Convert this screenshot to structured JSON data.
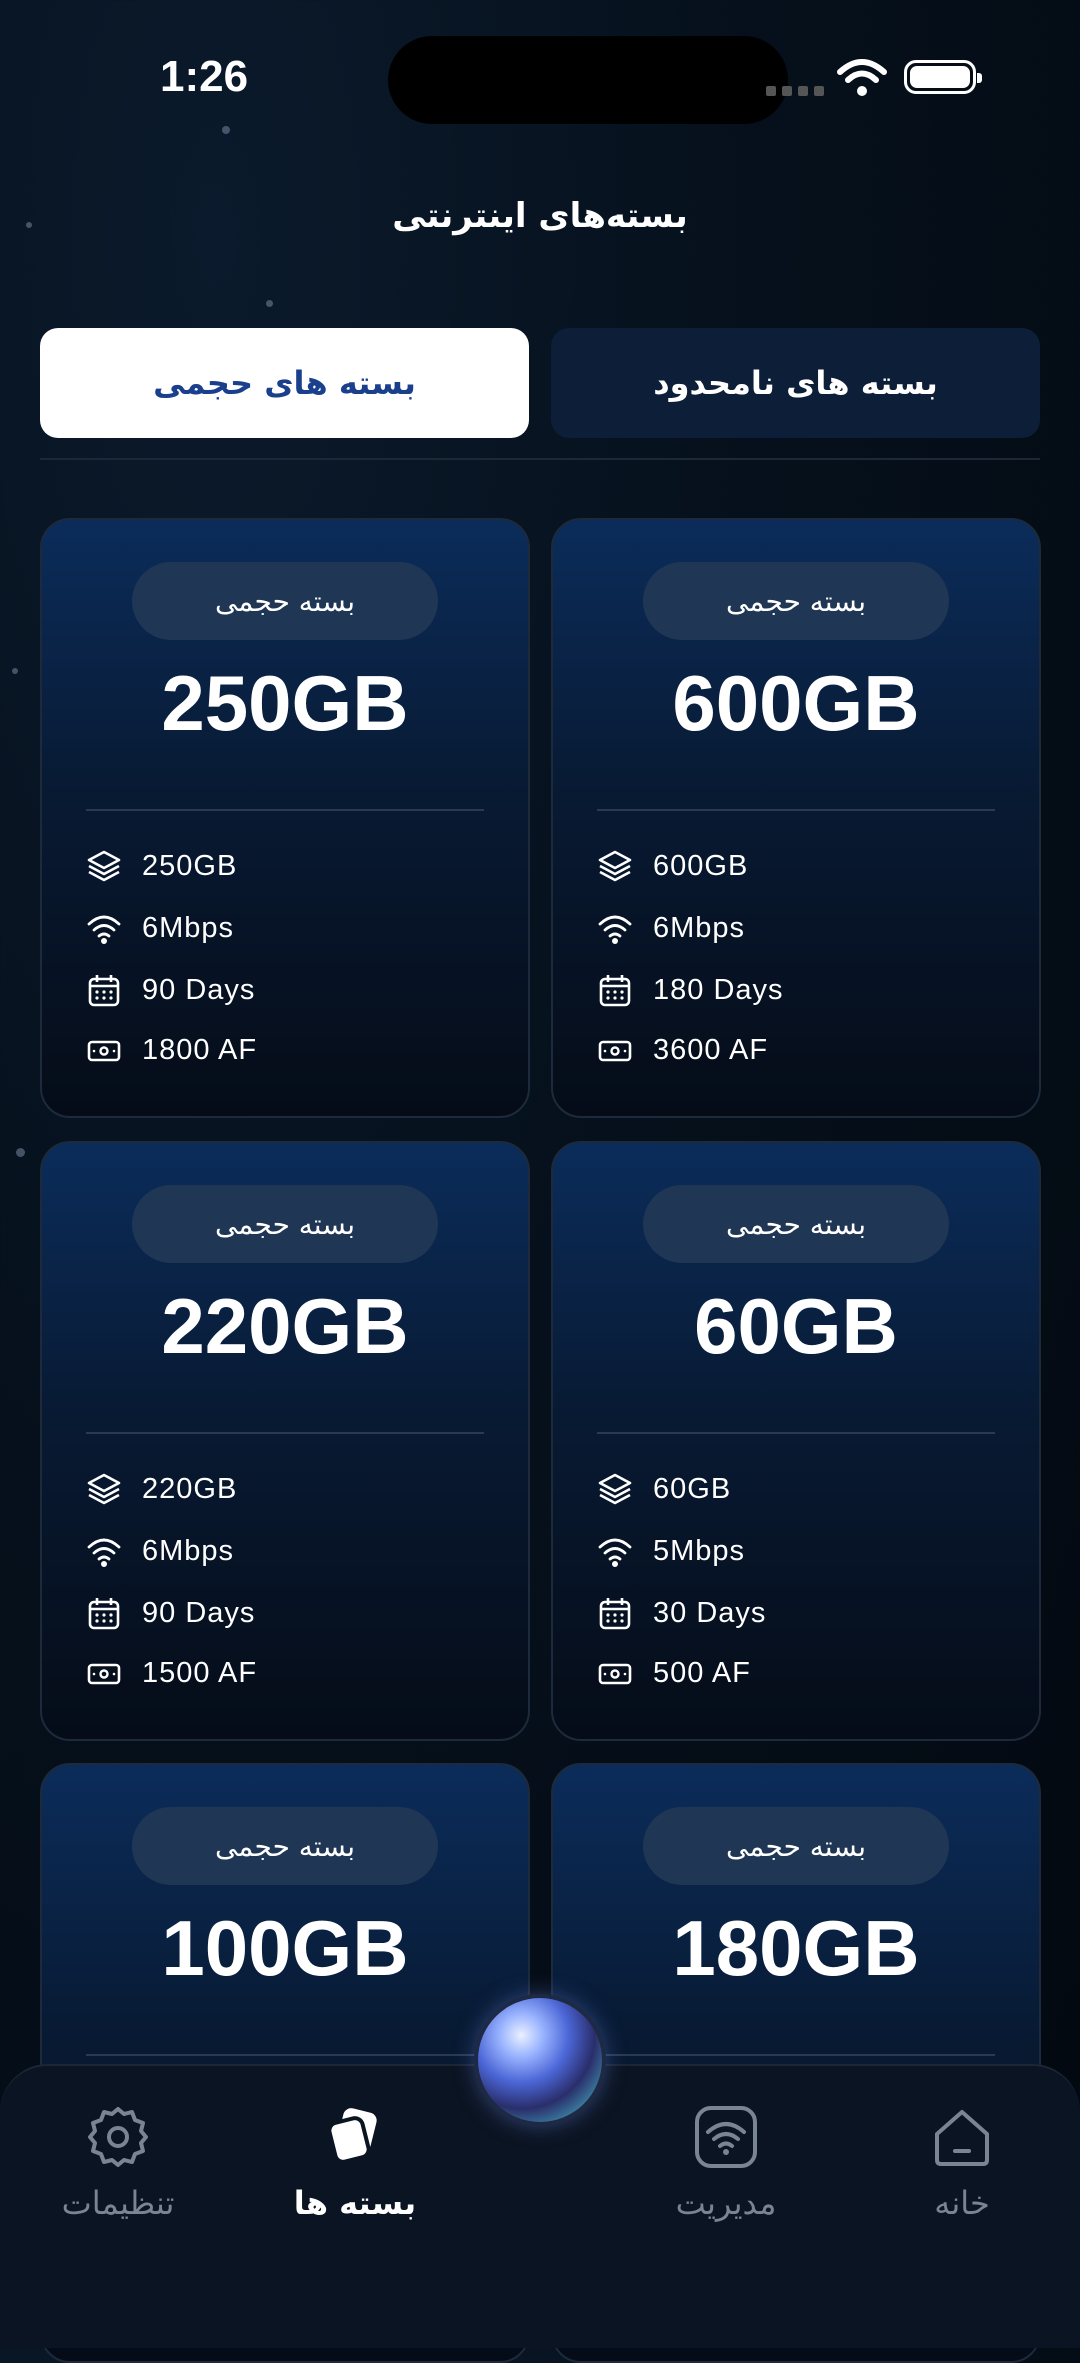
{
  "status_bar": {
    "time": "1:26"
  },
  "header": {
    "title": "بسته‌های اینترنتی"
  },
  "tabs": [
    {
      "label": "بسته های حجمی",
      "active": true
    },
    {
      "label": "بسته های نامحدود",
      "active": false
    }
  ],
  "colors": {
    "accent": "#1a3f8c",
    "card_top": "#0b2c5a",
    "background": "#03080f"
  },
  "cards": [
    {
      "badge": "بسته حجمی",
      "size": "600GB",
      "data": "600GB",
      "speed": "6Mbps",
      "duration": "180 Days",
      "price": "3600 AF"
    },
    {
      "badge": "بسته حجمی",
      "size": "250GB",
      "data": "250GB",
      "speed": "6Mbps",
      "duration": "90 Days",
      "price": "1800 AF"
    },
    {
      "badge": "بسته حجمی",
      "size": "60GB",
      "data": "60GB",
      "speed": "5Mbps",
      "duration": "30 Days",
      "price": "500 AF"
    },
    {
      "badge": "بسته حجمی",
      "size": "220GB",
      "data": "220GB",
      "speed": "6Mbps",
      "duration": "90 Days",
      "price": "1500 AF"
    },
    {
      "badge": "بسته حجمی",
      "size": "180GB"
    },
    {
      "badge": "بسته حجمی",
      "size": "100GB"
    }
  ],
  "bottom_nav": [
    {
      "label": "خانه",
      "icon": "home-icon"
    },
    {
      "label": "مدیریت",
      "icon": "wifi-manage-icon"
    },
    {
      "label": "بسته ها",
      "icon": "packages-icon",
      "active": true
    },
    {
      "label": "تنظیمات",
      "icon": "gear-icon"
    }
  ]
}
